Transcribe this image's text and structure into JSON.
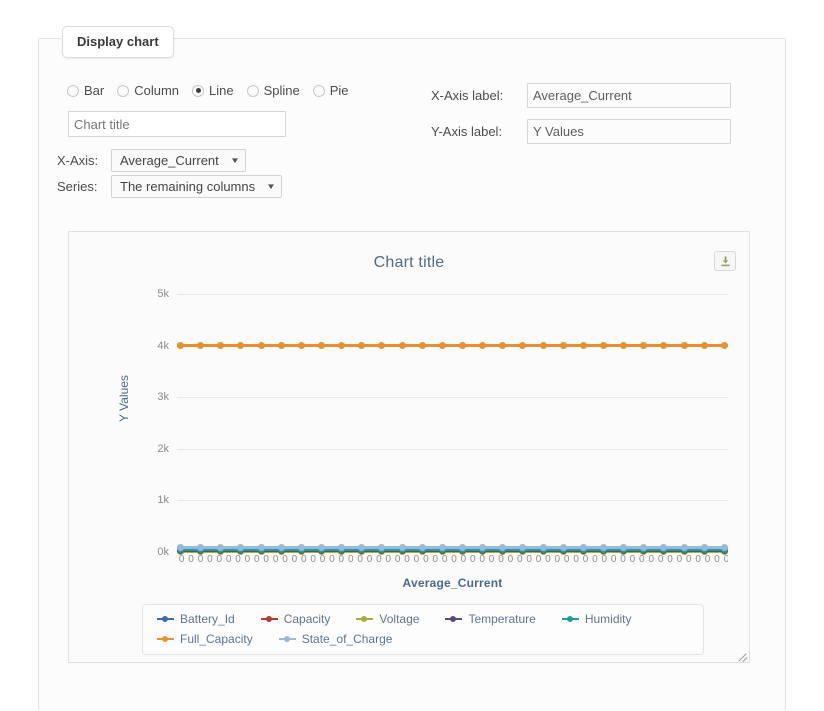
{
  "panel": {
    "tab_label": "Display chart"
  },
  "form": {
    "chart_types": [
      {
        "label": "Bar",
        "selected": false
      },
      {
        "label": "Column",
        "selected": false
      },
      {
        "label": "Line",
        "selected": true
      },
      {
        "label": "Spline",
        "selected": false
      },
      {
        "label": "Pie",
        "selected": false
      }
    ],
    "chart_title_input": {
      "value": "",
      "placeholder": "Chart title"
    },
    "x_axis_select": {
      "label": "X-Axis:",
      "value": "Average_Current"
    },
    "series_select": {
      "label": "Series:",
      "value": "The remaining columns"
    },
    "x_axis_label_field": {
      "label": "X-Axis label:",
      "value": "Average_Current"
    },
    "y_axis_label_field": {
      "label": "Y-Axis label:",
      "value": "Y Values"
    },
    "download_icon": "download-icon"
  },
  "chart_data": {
    "type": "line",
    "title": "Chart title",
    "xlabel": "Average_Current",
    "ylabel": "Y Values",
    "ylim": [
      0,
      5000
    ],
    "yticks": [
      "0k",
      "1k",
      "2k",
      "3k",
      "4k",
      "5k"
    ],
    "ytick_values": [
      0,
      1000,
      2000,
      3000,
      4000,
      5000
    ],
    "grid": true,
    "legend_position": "bottom",
    "x_tick_label": "0",
    "x_tick_count": 59,
    "x": [
      0,
      0,
      0,
      0,
      0,
      0,
      0,
      0,
      0,
      0,
      0,
      0,
      0,
      0,
      0,
      0,
      0,
      0,
      0,
      0,
      0,
      0,
      0,
      0,
      0,
      0,
      0,
      0,
      0,
      0,
      0,
      0,
      0,
      0,
      0,
      0,
      0,
      0,
      0,
      0,
      0,
      0,
      0,
      0,
      0,
      0,
      0,
      0,
      0,
      0,
      0,
      0,
      0,
      0,
      0,
      0,
      0,
      0,
      0
    ],
    "series": [
      {
        "name": "Battery_Id",
        "color": "#3a6ea8",
        "constant_value": 60
      },
      {
        "name": "Capacity",
        "color": "#b33a3a",
        "constant_value": 30
      },
      {
        "name": "Voltage",
        "color": "#a3b03a",
        "constant_value": 12
      },
      {
        "name": "Temperature",
        "color": "#5b4a7a",
        "constant_value": 25
      },
      {
        "name": "Humidity",
        "color": "#1f9d9d",
        "constant_value": 45
      },
      {
        "name": "Full_Capacity",
        "color": "#e3922f",
        "constant_value": 4000
      },
      {
        "name": "State_of_Charge",
        "color": "#9ab9d4",
        "constant_value": 80
      }
    ]
  }
}
